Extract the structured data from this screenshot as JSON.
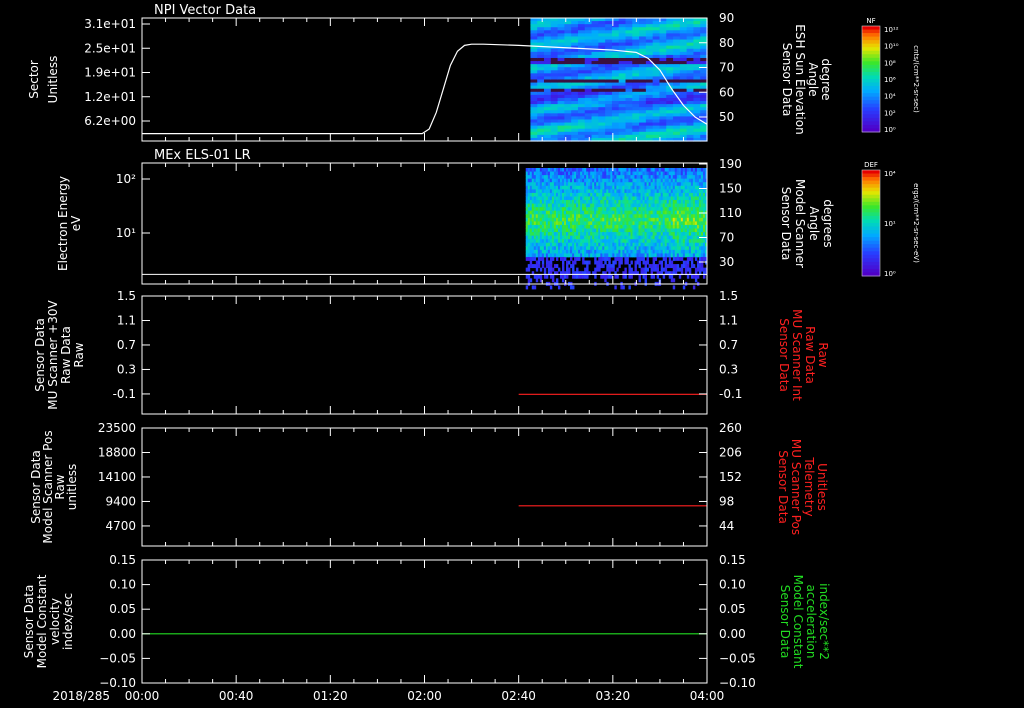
{
  "date_label": "2018/285",
  "colors": {
    "white": "#ffffff",
    "red": "#ff2020",
    "green": "#22dd22"
  },
  "chart_data": [
    {
      "type": "heatmap",
      "title": "NPI Vector Data",
      "ylabel": [
        "Sector",
        "Unitless"
      ],
      "y_ticks": [
        "3.1e+01",
        "2.5e+01",
        "1.9e+01",
        "1.2e+01",
        "6.2e+00"
      ],
      "y2label": [
        "Sensor Data",
        "ESH Sun Elevation",
        "Angle",
        "degree"
      ],
      "y2_ticks": [
        "90",
        "80",
        "70",
        "60",
        "50"
      ],
      "y2lim": [
        42,
        90
      ],
      "x_ticks": [
        "00:00",
        "00:40",
        "01:20",
        "02:00",
        "02:40",
        "03:20",
        "04:00"
      ],
      "x_minutes": [
        0,
        40,
        80,
        120,
        160,
        200,
        240
      ],
      "heatmap_start_minute": 165,
      "line_series": {
        "name": "ESH Sun Elevation Angle",
        "x_minutes": [
          0,
          60,
          119,
          122,
          125,
          128,
          131,
          134,
          137,
          140,
          145,
          160,
          180,
          200,
          210,
          215,
          220,
          225,
          230,
          235,
          240
        ],
        "values": [
          43,
          43,
          43,
          45,
          52,
          62,
          72,
          78,
          80.5,
          81,
          81,
          80.5,
          79.5,
          78.5,
          77.5,
          75,
          70,
          62,
          55,
          50,
          47
        ]
      },
      "colorbar": {
        "title": "NF",
        "units": "cnts/(cm**2-sr-sec)",
        "ticks": [
          "10¹²",
          "10¹⁰",
          "10⁸",
          "10⁶",
          "10⁴",
          "10²",
          "10⁰"
        ]
      }
    },
    {
      "type": "heatmap",
      "title": "MEx ELS-01 LR",
      "ylabel": [
        "Electron Energy",
        "eV"
      ],
      "y_ticks": [
        "10²",
        "10¹"
      ],
      "y2label": [
        "Sensor Data",
        "Model Scanner",
        "Angle",
        "degrees"
      ],
      "y2_ticks": [
        "190",
        "150",
        "110",
        "70",
        "30"
      ],
      "heatmap_start_minute": 163,
      "baseline_level": 0.08,
      "colorbar": {
        "title": "DEF",
        "units": "ergs/(cm**2-sr-sec-eV)",
        "ticks": [
          "10⁴",
          "10¹",
          "10⁰"
        ]
      }
    },
    {
      "type": "line",
      "ylabel": [
        "Sensor Data",
        "MU Scanner +30V",
        "Raw Data",
        "Raw"
      ],
      "y_ticks": [
        "1.5",
        "1.1",
        "0.7",
        "0.3",
        "-0.1"
      ],
      "y2label": [
        "Sensor Data",
        "MU Scanner Int",
        "Raw Data",
        "Raw"
      ],
      "y2_ticks": [
        "1.5",
        "1.1",
        "0.7",
        "0.3",
        "-0.1"
      ],
      "ylim": [
        -0.3,
        1.5
      ],
      "series": [
        {
          "x_minutes": [
            160,
            240
          ],
          "values": [
            0.0,
            0.0
          ]
        }
      ]
    },
    {
      "type": "line",
      "ylabel": [
        "Sensor Data",
        "Model Scanner Pos",
        "Raw",
        "unitless"
      ],
      "y_ticks": [
        "23500",
        "18800",
        "14100",
        "9400",
        "4700"
      ],
      "y2label": [
        "Sensor Data",
        "MU Scanner Pos",
        "Telemetry",
        "Unitless"
      ],
      "y2_ticks": [
        "260",
        "206",
        "152",
        "98",
        "44"
      ],
      "ylim": [
        0,
        23500
      ],
      "series": [
        {
          "x_minutes": [
            160,
            240
          ],
          "values": [
            8000,
            8000
          ]
        }
      ]
    },
    {
      "type": "line",
      "ylabel": [
        "Sensor Data",
        "Model Constant",
        "velocity",
        "index/sec"
      ],
      "y_ticks": [
        "0.15",
        "0.10",
        "0.05",
        "0.00",
        "−0.05",
        "−0.10"
      ],
      "y2label": [
        "Sensor Data",
        "Model Constant",
        "acceleration",
        "index/sec**2"
      ],
      "y2_ticks": [
        "0.15",
        "0.10",
        "0.05",
        "0.00",
        "−0.05",
        "−0.10"
      ],
      "ylim": [
        -0.1,
        0.15
      ],
      "series": [
        {
          "x_minutes": [
            0,
            240
          ],
          "values": [
            0.0,
            0.0
          ]
        }
      ]
    }
  ]
}
